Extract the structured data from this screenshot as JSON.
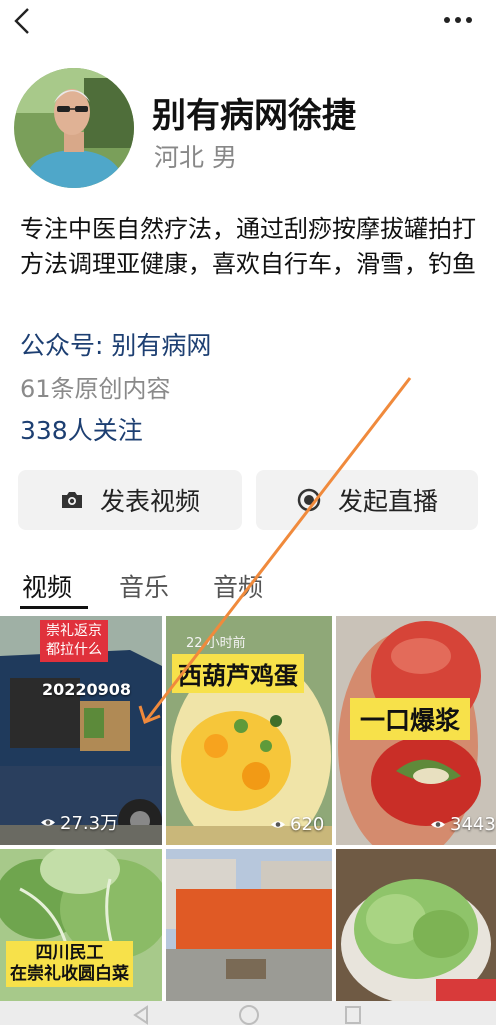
{
  "topbar": {
    "back_icon": "chevron-left-icon",
    "more_icon": "more-dots-icon"
  },
  "profile": {
    "name": "别有病网徐捷",
    "region": "河北",
    "gender": "男",
    "bio": "专注中医自然疗法，通过刮痧按摩拔罐拍打方法调理亚健康，喜欢自行车，滑雪，钓鱼",
    "official_account": "公众号: 别有病网",
    "original_count": "61条原创内容",
    "followers": "338人关注"
  },
  "actions": {
    "post_video": {
      "label": "发表视频",
      "icon": "camera-icon"
    },
    "start_live": {
      "label": "发起直播",
      "icon": "live-dot-icon"
    }
  },
  "tabs": [
    {
      "label": "视频",
      "active": true
    },
    {
      "label": "音乐",
      "active": false
    },
    {
      "label": "音频",
      "active": false
    }
  ],
  "videos": [
    {
      "caption_red": "崇礼返京\n都拉什么",
      "date": "20220908",
      "views": "27.3万"
    },
    {
      "time": "22 小时前",
      "caption": "西葫芦鸡蛋",
      "views": "620"
    },
    {
      "caption": "一口爆浆",
      "views": "3443"
    },
    {
      "caption": "四川民工\n在崇礼收圆白菜"
    },
    {
      "caption": ""
    },
    {
      "caption": ""
    }
  ],
  "colors": {
    "link": "#1d3f72",
    "annotation_arrow": "#f08a3c",
    "caption_yellow": "#f7e14a",
    "caption_red": "#e0313c"
  }
}
